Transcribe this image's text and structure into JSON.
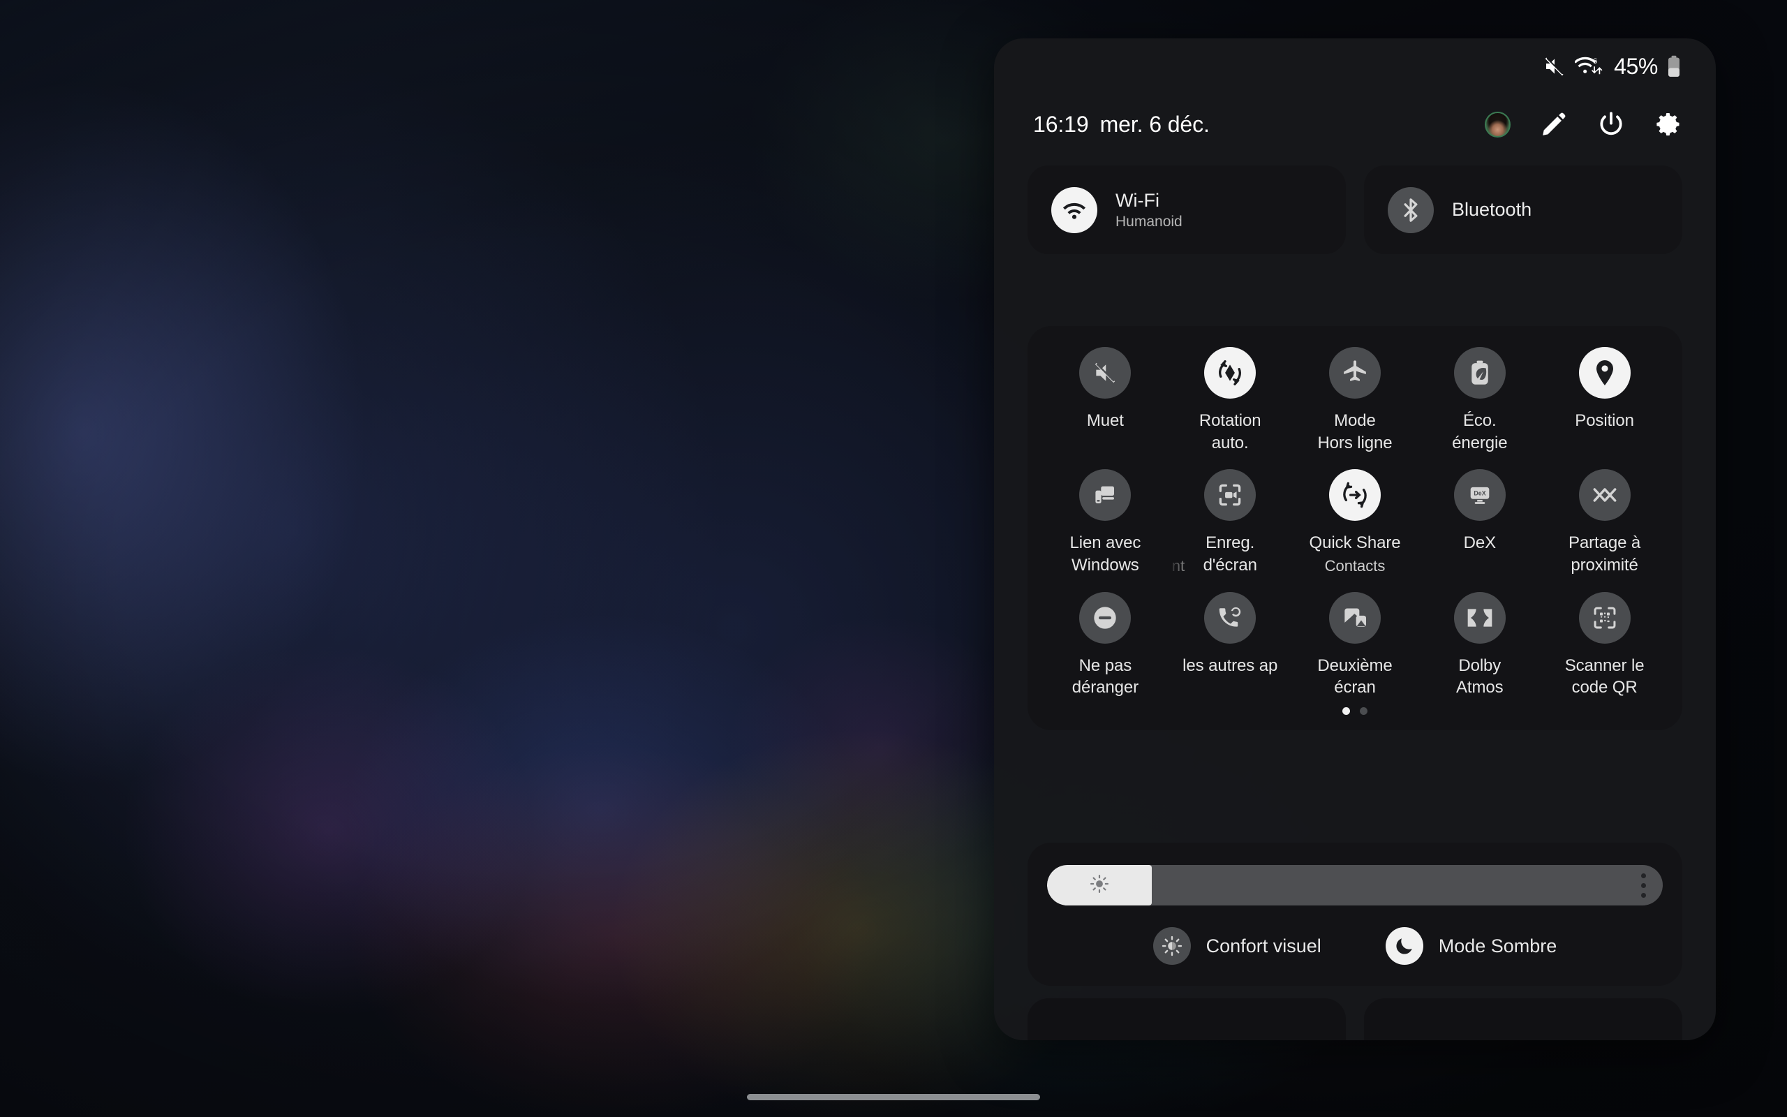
{
  "status_bar": {
    "mute_icon": "volume-mute-icon",
    "wifi_icon": "wifi-6-data-icon",
    "battery_percent": "45%",
    "battery_icon": "battery-icon",
    "battery_level": 45
  },
  "header": {
    "time": "16:19",
    "date": "mer. 6 déc.",
    "actions": [
      {
        "name": "avatar",
        "icon": "user-avatar"
      },
      {
        "name": "edit-button",
        "icon": "pencil-icon"
      },
      {
        "name": "power-button",
        "icon": "power-icon"
      },
      {
        "name": "settings-button",
        "icon": "gear-icon"
      }
    ]
  },
  "connectivity": [
    {
      "title": "Wi-Fi",
      "subtitle": "Humanoid",
      "icon": "wifi-icon",
      "state": "on"
    },
    {
      "title": "Bluetooth",
      "subtitle": "",
      "icon": "bluetooth-icon",
      "state": "off"
    }
  ],
  "tiles": {
    "rows": [
      [
        {
          "label": "Muet",
          "icon": "sound-mute-icon",
          "state": "off"
        },
        {
          "label": "Rotation\nauto.",
          "icon": "auto-rotate-icon",
          "state": "on"
        },
        {
          "label": "Mode\nHors ligne",
          "icon": "airplane-icon",
          "state": "off"
        },
        {
          "label": "Éco.\nénergie",
          "icon": "battery-leaf-icon",
          "state": "off"
        },
        {
          "label": "Position",
          "icon": "location-pin-icon",
          "state": "on"
        }
      ],
      [
        {
          "label": "Lien avec\nWindows",
          "icon": "link-to-windows-icon",
          "state": "off"
        },
        {
          "label": "Enreg.\nd'écran",
          "icon": "screen-record-icon",
          "state": "off"
        },
        {
          "label": "Quick Share",
          "icon": "quick-share-icon",
          "state": "on",
          "subtitle": "Contacts"
        },
        {
          "label": "DeX",
          "icon": "dex-icon",
          "state": "off"
        },
        {
          "label": "Partage à\nproximité",
          "icon": "nearby-share-icon",
          "state": "off"
        }
      ],
      [
        {
          "label": "Ne pas\ndéranger",
          "icon": "do-not-disturb-icon",
          "state": "off"
        },
        {
          "label": "les autres ap",
          "icon": "call-transfer-icon",
          "state": "off",
          "clipped": true
        },
        {
          "label": "Deuxième\nécran",
          "icon": "second-screen-icon",
          "state": "off"
        },
        {
          "label": "Dolby\nAtmos",
          "icon": "dolby-atmos-icon",
          "state": "off"
        },
        {
          "label": "Scanner le\ncode QR",
          "icon": "qr-scan-icon",
          "state": "off"
        }
      ]
    ],
    "quick_share_left_fragment": "nt",
    "page_dots": {
      "count": 2,
      "active_index": 0
    }
  },
  "brightness": {
    "value_percent": 17,
    "icon": "brightness-icon",
    "more_button": "more-options-icon"
  },
  "modes": [
    {
      "label": "Confort visuel",
      "icon": "eye-comfort-icon",
      "state": "off"
    },
    {
      "label": "Mode Sombre",
      "icon": "moon-icon",
      "state": "on"
    }
  ],
  "colors": {
    "panel_bg": "#17181b",
    "card_bg": "#131316",
    "tile_on": "#f3f3f3",
    "tile_off": "#4a4c4f",
    "text_primary": "#ececec",
    "text_secondary": "#b6b6b6"
  }
}
